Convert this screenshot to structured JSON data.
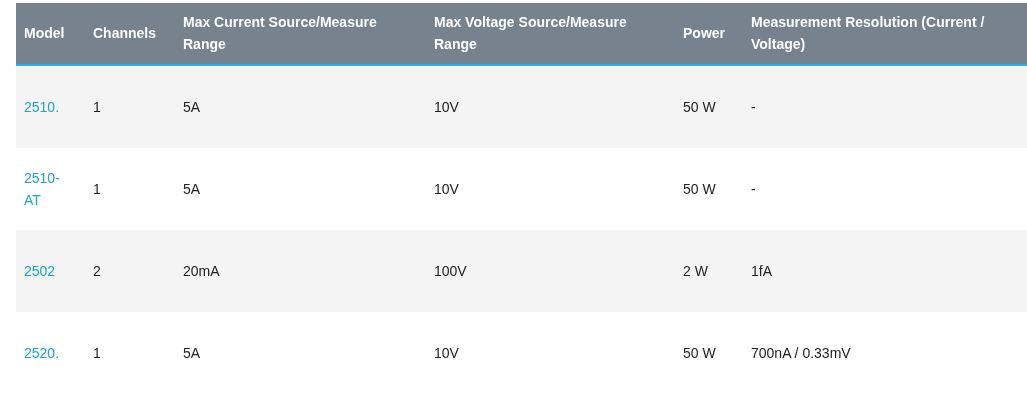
{
  "table": {
    "columns": [
      "Model",
      "Channels",
      "Max Current Source/Measure Range",
      "Max Voltage Source/Measure Range",
      "Power",
      "Measurement Resolution (Current / Voltage)"
    ],
    "rows": [
      {
        "cells": [
          "2510.",
          "1",
          "5A",
          "10V",
          "50 W",
          "-"
        ]
      },
      {
        "cells": [
          "2510-AT",
          "1",
          "5A",
          "10V",
          "50 W",
          "-"
        ]
      },
      {
        "cells": [
          "2502",
          "2",
          "20mA",
          "100V",
          "2 W",
          "1fA"
        ]
      },
      {
        "cells": [
          "2520.",
          "1",
          "5A",
          "10V",
          "50 W",
          "700nA / 0.33mV"
        ]
      }
    ]
  }
}
